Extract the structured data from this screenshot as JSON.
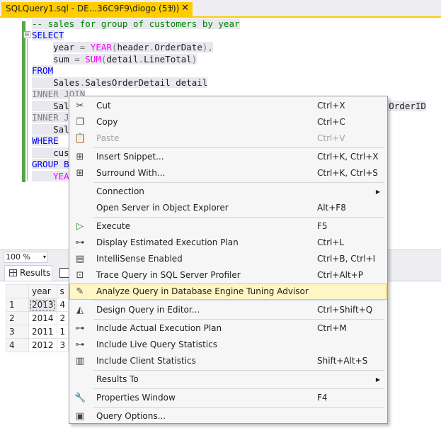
{
  "tab": {
    "title": "SQLQuery1.sql - DE...36C9F9\\diogo (51))",
    "pin": "⊣",
    "close": "✕"
  },
  "editor": {
    "outline_toggle": "⊟",
    "lines": [
      [
        {
          "t": "-- sales for group of customers by year",
          "c": "cm"
        }
      ],
      [
        {
          "t": "SELECT",
          "c": "kw"
        }
      ],
      [
        {
          "t": "    ",
          "c": ""
        },
        {
          "t": "year",
          "c": ""
        },
        {
          "t": " = ",
          "c": "gray"
        },
        {
          "t": "YEAR",
          "c": "fn"
        },
        {
          "t": "(",
          "c": "gray"
        },
        {
          "t": "header",
          "c": ""
        },
        {
          "t": ".",
          "c": "gray"
        },
        {
          "t": "OrderDate",
          "c": ""
        },
        {
          "t": "),",
          "c": "gray"
        }
      ],
      [
        {
          "t": "    ",
          "c": ""
        },
        {
          "t": "sum",
          "c": ""
        },
        {
          "t": " = ",
          "c": "gray"
        },
        {
          "t": "SUM",
          "c": "fn"
        },
        {
          "t": "(",
          "c": "gray"
        },
        {
          "t": "detail",
          "c": ""
        },
        {
          "t": ".",
          "c": "gray"
        },
        {
          "t": "LineTotal",
          "c": ""
        },
        {
          "t": ")",
          "c": "gray"
        }
      ],
      [
        {
          "t": "FROM",
          "c": "kw"
        }
      ],
      [
        {
          "t": "    Sales",
          "c": ""
        },
        {
          "t": ".",
          "c": "gray"
        },
        {
          "t": "SalesOrderDetail detail",
          "c": ""
        }
      ],
      [
        {
          "t": "INNER JOIN",
          "c": "gray"
        }
      ],
      [
        {
          "t": "    Sale",
          "c": ""
        },
        {
          "t": "                                                         ",
          "c": ""
        },
        {
          "t": "esOrderID",
          "c": ""
        }
      ],
      [
        {
          "t": "INNER JO",
          "c": "gray"
        }
      ],
      [
        {
          "t": "    Sale",
          "c": ""
        }
      ],
      [
        {
          "t": "WHERE",
          "c": "kw"
        }
      ],
      [
        {
          "t": "    cust",
          "c": ""
        }
      ],
      [
        {
          "t": "GROUP BY",
          "c": "kw"
        }
      ],
      [
        {
          "t": "    YEAR",
          "c": "fn"
        }
      ]
    ]
  },
  "zoom": {
    "value": "100 %",
    "arrow": "▾"
  },
  "results": {
    "tab_label": "Results",
    "columns": [
      "",
      "year",
      "s"
    ],
    "rows": [
      [
        "1",
        "2013",
        "4"
      ],
      [
        "2",
        "2014",
        "2"
      ],
      [
        "3",
        "2011",
        "1"
      ],
      [
        "4",
        "2012",
        "3"
      ]
    ]
  },
  "context_menu": {
    "items": [
      {
        "label": "Cut",
        "shortcut": "Ctrl+X",
        "icon": "scissors-icon",
        "glyph": "✂"
      },
      {
        "label": "Copy",
        "shortcut": "Ctrl+C",
        "icon": "copy-icon",
        "glyph": "❐"
      },
      {
        "label": "Paste",
        "shortcut": "Ctrl+V",
        "icon": "paste-icon",
        "glyph": "📋",
        "disabled": true
      },
      {
        "sep": true
      },
      {
        "label": "Insert Snippet...",
        "shortcut": "Ctrl+K, Ctrl+X",
        "icon": "insert-snippet-icon",
        "glyph": "⊞"
      },
      {
        "label": "Surround With...",
        "shortcut": "Ctrl+K, Ctrl+S",
        "icon": "surround-with-icon",
        "glyph": "⊞"
      },
      {
        "sep": true
      },
      {
        "label": "Connection",
        "shortcut": "",
        "submenu": true
      },
      {
        "label": "Open Server in Object Explorer",
        "shortcut": "Alt+F8"
      },
      {
        "sep": true
      },
      {
        "label": "Execute",
        "shortcut": "F5",
        "icon": "execute-icon",
        "glyph": "▷"
      },
      {
        "label": "Display Estimated Execution Plan",
        "shortcut": "Ctrl+L",
        "icon": "estimated-plan-icon",
        "glyph": "⊶"
      },
      {
        "label": "IntelliSense Enabled",
        "shortcut": "Ctrl+B, Ctrl+I",
        "icon": "intellisense-icon",
        "glyph": "▤"
      },
      {
        "label": "Trace Query in SQL Server Profiler",
        "shortcut": "Ctrl+Alt+P",
        "icon": "profiler-icon",
        "glyph": "⊡"
      },
      {
        "label": "Analyze Query in Database Engine Tuning Advisor",
        "shortcut": "",
        "icon": "tuning-advisor-icon",
        "glyph": "✎",
        "hover": true
      },
      {
        "sep": true
      },
      {
        "label": "Design Query in Editor...",
        "shortcut": "Ctrl+Shift+Q",
        "icon": "design-query-icon",
        "glyph": "◭"
      },
      {
        "sep": true
      },
      {
        "label": "Include Actual Execution Plan",
        "shortcut": "Ctrl+M",
        "icon": "actual-plan-icon",
        "glyph": "⊶"
      },
      {
        "label": "Include Live Query Statistics",
        "shortcut": "",
        "icon": "live-stats-icon",
        "glyph": "⊶"
      },
      {
        "label": "Include Client Statistics",
        "shortcut": "Shift+Alt+S",
        "icon": "client-stats-icon",
        "glyph": "▥"
      },
      {
        "sep": true
      },
      {
        "label": "Results To",
        "shortcut": "",
        "submenu": true
      },
      {
        "sep": true
      },
      {
        "label": "Properties Window",
        "shortcut": "F4",
        "icon": "wrench-icon",
        "glyph": "🔧"
      },
      {
        "sep": true
      },
      {
        "label": "Query Options...",
        "shortcut": "",
        "icon": "query-options-icon",
        "glyph": "▣"
      }
    ]
  }
}
